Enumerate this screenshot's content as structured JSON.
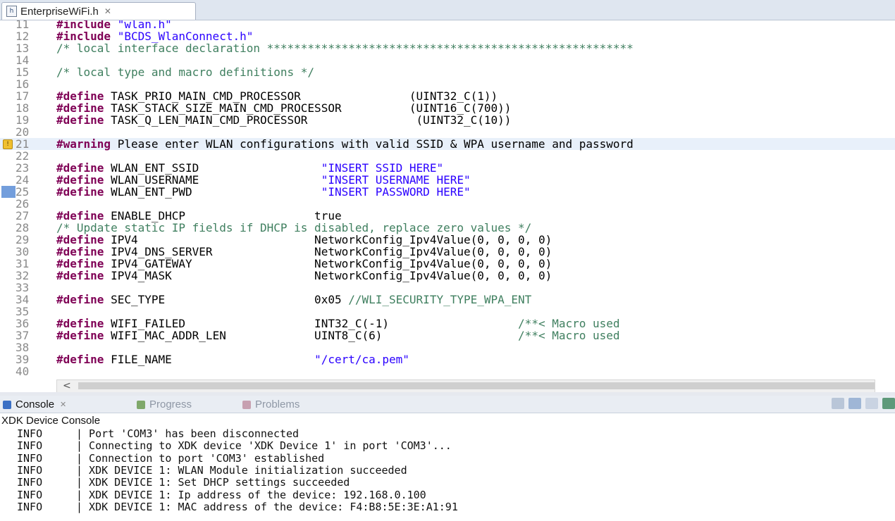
{
  "editor_tab": {
    "title": "EnterpriseWiFi.h",
    "close": "✕"
  },
  "code_lines": [
    {
      "n": "11",
      "parts": [
        [
          "kw",
          "#include"
        ],
        [
          "st",
          " \"wlan.h\""
        ]
      ]
    },
    {
      "n": "12",
      "parts": [
        [
          "kw",
          "#include"
        ],
        [
          "st",
          " \"BCDS_WlanConnect.h\""
        ]
      ]
    },
    {
      "n": "13",
      "parts": [
        [
          "cm",
          "/* local interface declaration ******************************************************"
        ]
      ]
    },
    {
      "n": "14",
      "parts": []
    },
    {
      "n": "15",
      "parts": [
        [
          "cm",
          "/* local type and macro definitions */"
        ]
      ]
    },
    {
      "n": "16",
      "parts": []
    },
    {
      "n": "17",
      "parts": [
        [
          "kw",
          "#define"
        ],
        [
          "tx",
          " TASK_PRIO_MAIN_CMD_PROCESSOR                (UINT32_C(1))"
        ]
      ]
    },
    {
      "n": "18",
      "parts": [
        [
          "kw",
          "#define"
        ],
        [
          "tx",
          " TASK_STACK_SIZE_MAIN_CMD_PROCESSOR          (UINT16_C(700))"
        ]
      ]
    },
    {
      "n": "19",
      "parts": [
        [
          "kw",
          "#define"
        ],
        [
          "tx",
          " TASK_Q_LEN_MAIN_CMD_PROCESSOR                (UINT32_C(10))"
        ]
      ]
    },
    {
      "n": "20",
      "parts": []
    },
    {
      "n": "21",
      "mark": "warning",
      "hl": true,
      "parts": [
        [
          "kw",
          "#warning"
        ],
        [
          "tx",
          " Please enter WLAN configurations with valid SSID & WPA username and password"
        ]
      ]
    },
    {
      "n": "22",
      "parts": []
    },
    {
      "n": "23",
      "parts": [
        [
          "kw",
          "#define"
        ],
        [
          "tx",
          " WLAN_ENT_SSID                  "
        ],
        [
          "st",
          "\"INSERT SSID HERE\""
        ]
      ]
    },
    {
      "n": "24",
      "parts": [
        [
          "kw",
          "#define"
        ],
        [
          "tx",
          " WLAN_USERNAME                  "
        ],
        [
          "st",
          "\"INSERT USERNAME HERE\""
        ]
      ]
    },
    {
      "n": "25",
      "mark": "bookmark",
      "parts": [
        [
          "kw",
          "#define"
        ],
        [
          "tx",
          " WLAN_ENT_PWD                   "
        ],
        [
          "st",
          "\"INSERT PASSWORD HERE\""
        ]
      ]
    },
    {
      "n": "26",
      "parts": []
    },
    {
      "n": "27",
      "parts": [
        [
          "kw",
          "#define"
        ],
        [
          "tx",
          " ENABLE_DHCP                   true"
        ]
      ]
    },
    {
      "n": "28",
      "parts": [
        [
          "cm",
          "/* Update static IP fields if DHCP is disabled, replace zero values */"
        ]
      ]
    },
    {
      "n": "29",
      "parts": [
        [
          "kw",
          "#define"
        ],
        [
          "tx",
          " IPV4                          NetworkConfig_Ipv4Value(0, 0, 0, 0)"
        ]
      ]
    },
    {
      "n": "30",
      "parts": [
        [
          "kw",
          "#define"
        ],
        [
          "tx",
          " IPV4_DNS_SERVER               NetworkConfig_Ipv4Value(0, 0, 0, 0)"
        ]
      ]
    },
    {
      "n": "31",
      "parts": [
        [
          "kw",
          "#define"
        ],
        [
          "tx",
          " IPV4_GATEWAY                  NetworkConfig_Ipv4Value(0, 0, 0, 0)"
        ]
      ]
    },
    {
      "n": "32",
      "parts": [
        [
          "kw",
          "#define"
        ],
        [
          "tx",
          " IPV4_MASK                     NetworkConfig_Ipv4Value(0, 0, 0, 0)"
        ]
      ]
    },
    {
      "n": "33",
      "parts": []
    },
    {
      "n": "34",
      "parts": [
        [
          "kw",
          "#define"
        ],
        [
          "tx",
          " SEC_TYPE                      0x05 "
        ],
        [
          "cm",
          "//WLI_SECURITY_TYPE_WPA_ENT"
        ]
      ]
    },
    {
      "n": "35",
      "parts": []
    },
    {
      "n": "36",
      "parts": [
        [
          "kw",
          "#define"
        ],
        [
          "tx",
          " WIFI_FAILED                   INT32_C(-1)                   "
        ],
        [
          "cm",
          "/**< Macro used"
        ]
      ]
    },
    {
      "n": "37",
      "parts": [
        [
          "kw",
          "#define"
        ],
        [
          "tx",
          " WIFI_MAC_ADDR_LEN             UINT8_C(6)                    "
        ],
        [
          "cm",
          "/**< Macro used"
        ]
      ]
    },
    {
      "n": "38",
      "parts": []
    },
    {
      "n": "39",
      "parts": [
        [
          "kw",
          "#define"
        ],
        [
          "tx",
          " FILE_NAME                     "
        ],
        [
          "st",
          "\"/cert/ca.pem\""
        ]
      ]
    },
    {
      "n": "40",
      "parts": []
    }
  ],
  "hscroll": {
    "left_arrow": "<"
  },
  "console_tabs": [
    {
      "label": "Console",
      "suffix": "✕",
      "active": true,
      "icon": "console-icon",
      "color": "#3a6fc4"
    },
    {
      "label": "Progress",
      "suffix": "",
      "active": false,
      "icon": "progress-icon",
      "color": "#7fa86a"
    },
    {
      "label": "Problems",
      "suffix": "",
      "active": false,
      "icon": "problems-icon",
      "color": "#c7a0b0"
    }
  ],
  "console_title": "XDK Device Console",
  "console_lines": [
    {
      "level": "INFO",
      "text": "| Port 'COM3' has been disconnected"
    },
    {
      "level": "INFO",
      "text": "| Connecting to XDK device 'XDK Device 1' in port 'COM3'..."
    },
    {
      "level": "INFO",
      "text": "| Connection to port 'COM3' established"
    },
    {
      "level": "INFO",
      "text": "| XDK DEVICE 1: WLAN Module initialization succeeded"
    },
    {
      "level": "INFO",
      "text": "| XDK DEVICE 1: Set DHCP settings succeeded"
    },
    {
      "level": "INFO",
      "text": "| XDK DEVICE 1: Ip address of the device: 192.168.0.100"
    },
    {
      "level": "INFO",
      "text": "| XDK DEVICE 1: MAC address of the device: F4:B8:5E:3E:A1:91"
    }
  ],
  "colors": {
    "keyword": "#7f0055",
    "comment": "#3f7f5f",
    "string": "#2a00ff"
  }
}
